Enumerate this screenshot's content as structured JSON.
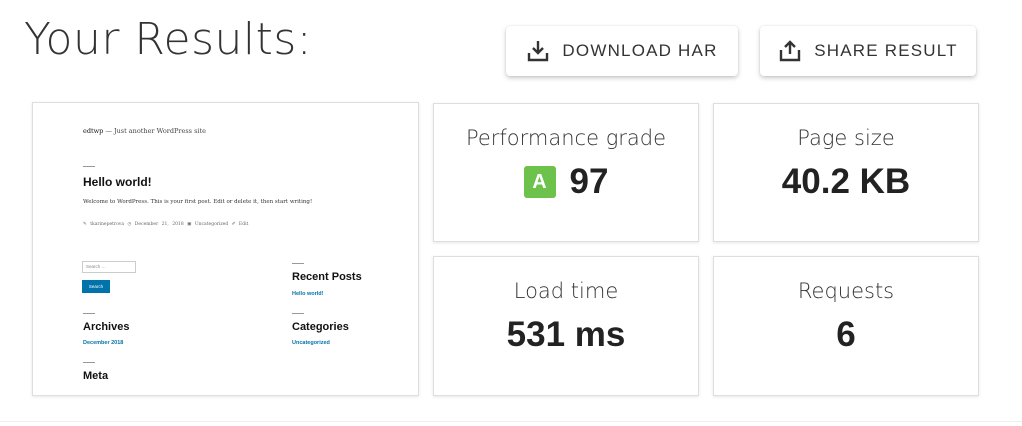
{
  "header": {
    "title": "Your Results:",
    "download_label": "DOWNLOAD HAR",
    "share_label": "SHARE RESULT"
  },
  "preview": {
    "site_name": "edtwp",
    "tagline": "— Just another WordPress site",
    "post_title": "Hello world!",
    "post_body": "Welcome to WordPress. This is your first post. Edit or delete it, then start writing!",
    "meta_author": "✎ tkarinepetrova",
    "meta_date": "◷ December 21, 2018",
    "meta_category": "▣ Uncategorized",
    "meta_edit": "✐ Edit",
    "search_placeholder": "Search …",
    "search_button": "Search",
    "recent_posts_title": "Recent Posts",
    "recent_post_link": "Hello world!",
    "archives_title": "Archives",
    "archive_link": "December 2018",
    "categories_title": "Categories",
    "category_link": "Uncategorized",
    "meta_title": "Meta"
  },
  "metrics": {
    "performance": {
      "label": "Performance grade",
      "grade": "A",
      "value": "97"
    },
    "page_size": {
      "label": "Page size",
      "value": "40.2 KB"
    },
    "load_time": {
      "label": "Load time",
      "value": "531 ms"
    },
    "requests": {
      "label": "Requests",
      "value": "6"
    }
  },
  "colors": {
    "grade_badge": "#6cc24a",
    "wp_link": "#0073aa"
  }
}
